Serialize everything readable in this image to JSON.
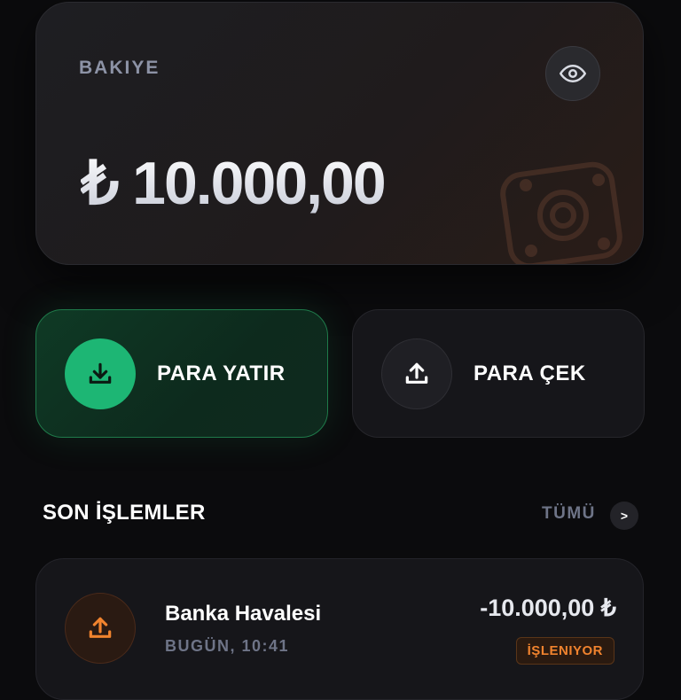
{
  "balance": {
    "label": "BAKIYE",
    "amount": "₺ 10.000,00",
    "toggle_icon": "eye-icon",
    "decoration_icon": "safe-icon"
  },
  "actions": {
    "deposit": {
      "label": "PARA YATIR",
      "icon": "download-icon",
      "color": "#1db674"
    },
    "withdraw": {
      "label": "PARA ÇEK",
      "icon": "upload-icon"
    }
  },
  "transactions": {
    "title": "SON İŞLEMLER",
    "see_all": "TÜMÜ",
    "see_all_arrow": ">",
    "items": [
      {
        "title": "Banka Havalesi",
        "date": "BUGÜN, 10:41",
        "amount": "-10.000,00 ₺",
        "status": "İŞLENIYOR",
        "icon": "upload-icon",
        "status_color": "#f0832e"
      }
    ]
  }
}
